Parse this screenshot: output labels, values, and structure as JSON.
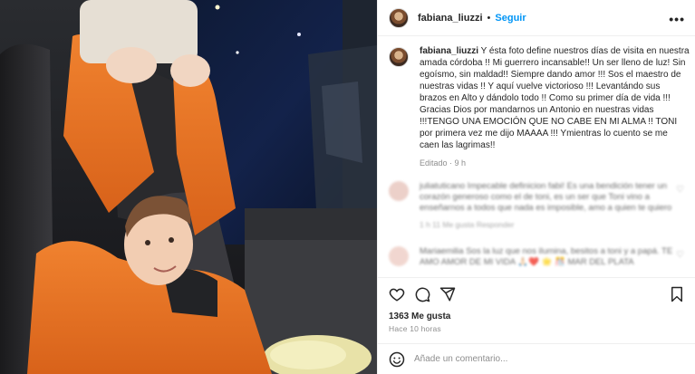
{
  "post": {
    "username": "fabiana_liuzzi",
    "separator": "•",
    "follow_label": "Seguir",
    "more_label": "•••"
  },
  "caption": {
    "username": "fabiana_liuzzi",
    "text": "Y ésta foto define nuestros días de visita en nuestra amada córdoba !! Mi guerrero incansable!! Un ser lleno de luz! Sin egoísmo, sin maldad!! Siempre dando amor !!! Sos el maestro de nuestras vidas !! Y aquí vuelve victorioso !!! Levantándo sus brazos en Alto y dándolo todo !! Como su primer día de vida !!! Gracias Dios por mandarnos un Antonio en nuestras vidas !!!TENGO UNA EMOCIÓN QUE NO CABE EN MI ALMA !! TONI por primera vez me dijo MAAAA !!! Ymientras lo cuento se me caen las lagrimas!!",
    "meta": "Editado · 9 h"
  },
  "comments": [
    {
      "text": "juliatuticano Impecable definicion fabi! Es una bendición tener un corazón generoso como el de toni, es un ser que Toni vino a enseñarnos a todos que nada es imposible, amo a quien te quiero",
      "meta": "1 h   11 Me gusta   Responder"
    },
    {
      "text": "Mariaemilia Sos la luz que nos ilumina, besitos a toni y a papá. TE AMO AMOR DE MI VIDA 🙏🏻❤️ 🌟 🎊 MAR DEL PLATA",
      "meta": ""
    }
  ],
  "stats": {
    "likes": "1363 Me gusta",
    "time_ago": "Hace 10 horas"
  },
  "comment_box": {
    "placeholder": "Añade un comentario..."
  },
  "colors": {
    "accent": "#0095f6",
    "text": "#262626",
    "muted": "#8e8e8e",
    "sweater": "#e87022"
  },
  "icons": [
    "heart-icon",
    "comment-icon",
    "share-icon",
    "bookmark-icon",
    "emoji-icon",
    "more-options-icon"
  ]
}
